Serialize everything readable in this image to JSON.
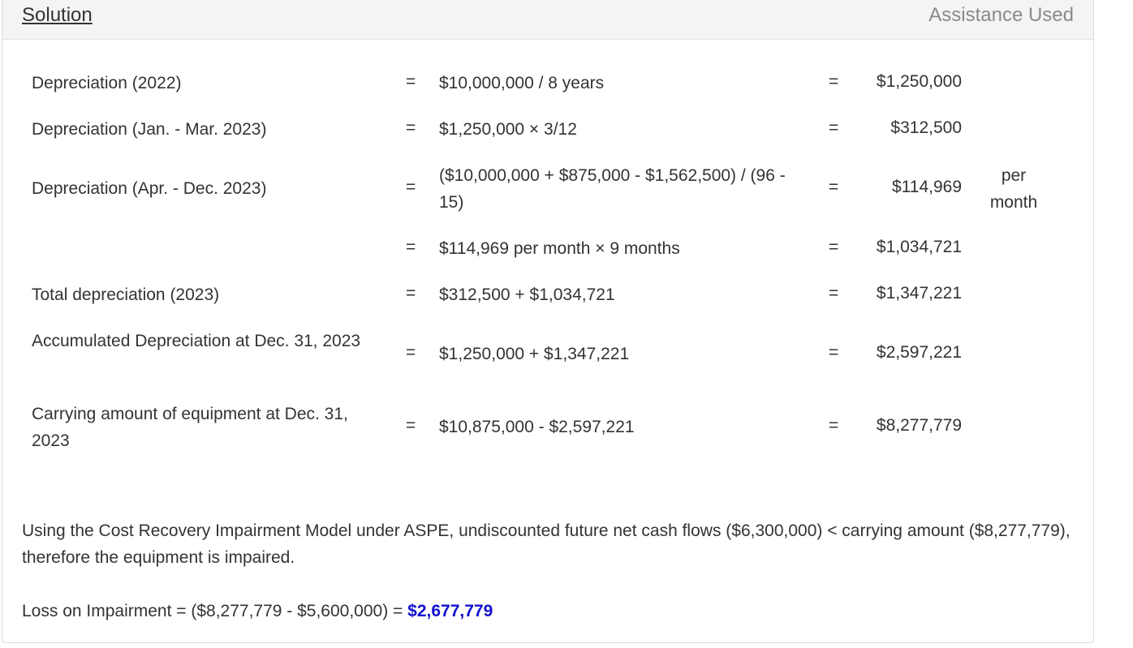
{
  "header": {
    "solution_tab": "Solution",
    "assistance_label": "Assistance Used"
  },
  "rows": [
    {
      "label": "Depreciation (2022)",
      "eq1": "=",
      "expr": "$10,000,000 / 8 years",
      "eq2": "=",
      "result": "$1,250,000",
      "unit": ""
    },
    {
      "label": "Depreciation (Jan. - Mar. 2023)",
      "eq1": "=",
      "expr": "$1,250,000 × 3/12",
      "eq2": "=",
      "result": "$312,500",
      "unit": ""
    },
    {
      "label": "Depreciation (Apr. - Dec. 2023)",
      "eq1": "=",
      "expr": "($10,000,000 + $875,000 - $1,562,500) / (96 - 15)",
      "eq2": "=",
      "result": "$114,969",
      "unit": "per month"
    },
    {
      "label": "",
      "eq1": "=",
      "expr": "$114,969 per month × 9 months",
      "eq2": "=",
      "result": "$1,034,721",
      "unit": ""
    },
    {
      "label": "Total depreciation (2023)",
      "eq1": "=",
      "expr": "$312,500 + $1,034,721",
      "eq2": "=",
      "result": "$1,347,221",
      "unit": ""
    },
    {
      "label": "Accumulated Depreciation at Dec. 31, 2023",
      "eq1": "=",
      "expr": "$1,250,000 + $1,347,221",
      "eq2": "=",
      "result": "$2,597,221",
      "unit": ""
    },
    {
      "label": "Carrying amount of equipment at Dec. 31, 2023",
      "eq1": "=",
      "expr": "$10,875,000 - $2,597,221",
      "eq2": "=",
      "result": "$8,277,779",
      "unit": ""
    }
  ],
  "conclusion": "Using the Cost Recovery Impairment Model under ASPE, undiscounted future net cash flows ($6,300,000) < carrying amount ($8,277,779), therefore the equipment is impaired.",
  "loss": {
    "prefix": "Loss on Impairment = ($8,277,779 - $5,600,000) = ",
    "value": "$2,677,779",
    "value_color": "#1111cc"
  }
}
